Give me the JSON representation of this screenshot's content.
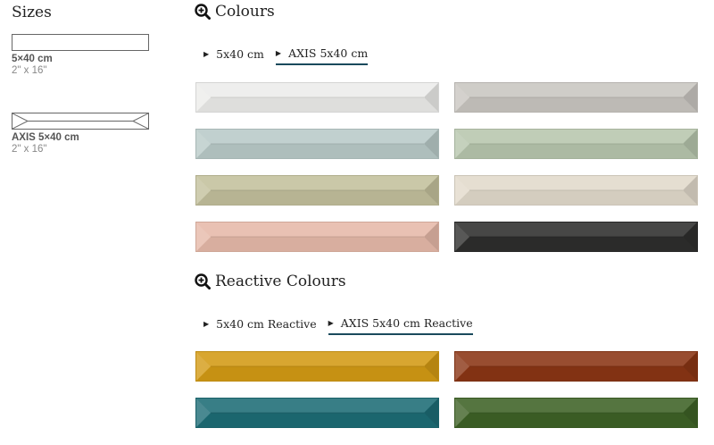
{
  "sizes": {
    "title": "Sizes",
    "items": [
      {
        "name": "5×40 cm",
        "inches": "2\" x 16\""
      },
      {
        "name": "AXIS 5×40 cm",
        "inches": "2\" x 16\""
      }
    ]
  },
  "colours": {
    "title": "Colours",
    "tabs": [
      {
        "label": "5x40 cm",
        "active": false
      },
      {
        "label": "AXIS 5x40 cm",
        "active": true
      }
    ],
    "tiles": [
      "#ececea",
      "#c9c6c1",
      "#b9cac8",
      "#b7c6ad",
      "#c3c09c",
      "#e2dacb",
      "#e6b9a9",
      "#2e2e2d"
    ]
  },
  "reactive": {
    "title": "Reactive Colours",
    "tabs": [
      {
        "label": "5x40 cm Reactive",
        "active": false
      },
      {
        "label": "AXIS 5x40 cm Reactive",
        "active": true
      }
    ],
    "tiles": [
      "#d39a14",
      "#8a3514",
      "#1d6c75",
      "#3e6226"
    ]
  },
  "icons": {
    "zoom": "zoom-in-icon",
    "tab": "triangle-right-icon"
  }
}
